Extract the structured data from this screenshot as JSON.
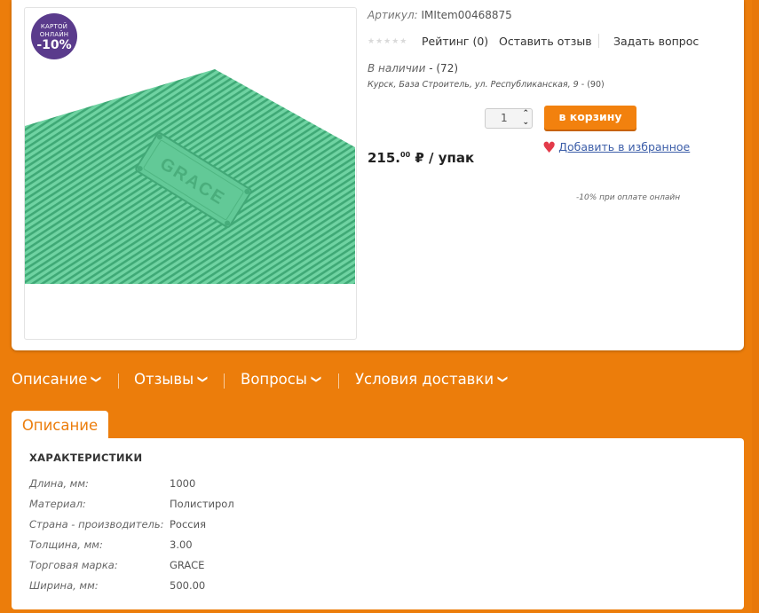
{
  "product": {
    "badge_top": "КАРТОЙ",
    "badge_mid": "ОНЛАЙН",
    "badge_pct": "-10%",
    "brand_on_product": "GRACE",
    "article_label": "Артикул:",
    "article_value": "IMItem00468875",
    "rating_label": "Рейтинг (0)",
    "leave_review": "Оставить отзыв",
    "ask_question": "Задать вопрос",
    "stock_label": "В наличии",
    "stock_count": "- (72)",
    "store_address": "Курск, База Строитель, ул. Республиканская, 9",
    "store_count": "- (90)",
    "quantity": "1",
    "cart_button": "в корзину",
    "favorite": "Добавить в избранное",
    "price_main": "215.",
    "price_cents": "00",
    "price_unit": " ₽ / упак",
    "online_discount_note": "-10% при оплате онлайн"
  },
  "tabs": [
    {
      "label": "Описание"
    },
    {
      "label": "Отзывы"
    },
    {
      "label": "Вопросы"
    },
    {
      "label": "Условия доставки"
    }
  ],
  "description": {
    "tab_label": "Описание",
    "title": "ХАРАКТЕРИСТИКИ",
    "rows": [
      {
        "name": "Длина, мм:",
        "value": "1000"
      },
      {
        "name": "Материал:",
        "value": "Полистирол"
      },
      {
        "name": "Страна - производитель:",
        "value": "Россия"
      },
      {
        "name": "Толщина, мм:",
        "value": "3.00"
      },
      {
        "name": "Торговая марка:",
        "value": "GRACE"
      },
      {
        "name": "Ширина, мм:",
        "value": "500.00"
      }
    ]
  },
  "colors": {
    "background": "#ec7d0b",
    "badge": "#5a3b8c",
    "product_green": "#5ec897",
    "link": "#3b5da8"
  },
  "icons": {
    "heart": "heart-icon",
    "chevron": "chevron-down-icon",
    "stepper": "stepper-arrows-icon"
  }
}
